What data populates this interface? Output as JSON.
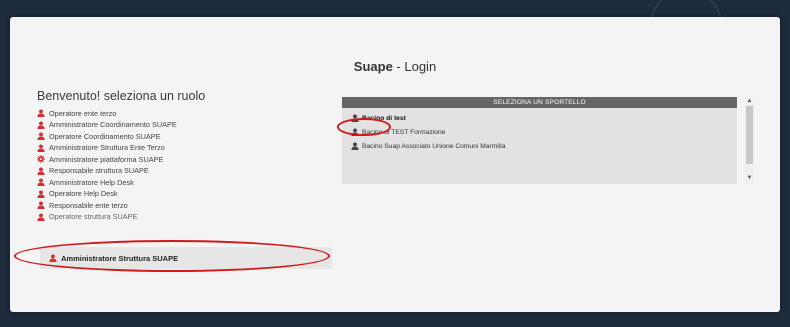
{
  "login": {
    "title_bold": "Suape",
    "title_rest": " - Login",
    "welcome": "Benvenuto! seleziona un ruolo",
    "roles": [
      {
        "label": "Operatore ente terzo",
        "icon": "user-icon",
        "color": "#d32f2f"
      },
      {
        "label": "Amministratore Coordinamento SUAPE",
        "icon": "user-icon",
        "color": "#d32f2f"
      },
      {
        "label": "Operatore Coordinamento SUAPE",
        "icon": "user-icon",
        "color": "#d32f2f"
      },
      {
        "label": "Amministratore Struttura Ente Terzo",
        "icon": "user-icon",
        "color": "#d32f2f"
      },
      {
        "label": "Amministratore piattaforma SUAPE",
        "icon": "gear-icon",
        "color": "#d32f2f"
      },
      {
        "label": "Responsabile struttura SUAPE",
        "icon": "user-icon",
        "color": "#d32f2f"
      },
      {
        "label": "Amministratore Help Desk",
        "icon": "user-icon",
        "color": "#d32f2f"
      },
      {
        "label": "Operatore Help Desk",
        "icon": "user-icon",
        "color": "#d32f2f"
      },
      {
        "label": "Responsabile ente terzo",
        "icon": "user-icon",
        "color": "#d32f2f"
      },
      {
        "label": "Operatore struttura SUAPE",
        "icon": "user-icon",
        "color": "#d32f2f"
      }
    ],
    "selected_role": "Amministratore Struttura SUAPE"
  },
  "sportello": {
    "header": "SELEZIONA UN SPORTELLO",
    "items": [
      {
        "label": "Bacino di test"
      },
      {
        "label": "Bacino di TEST Formazione"
      },
      {
        "label": "Bacino Suap Associato Unione Comuni Marmilla"
      }
    ]
  },
  "colors": {
    "accent": "#d01a1a",
    "icon_dark": "#444444",
    "header_bg": "#666666"
  }
}
